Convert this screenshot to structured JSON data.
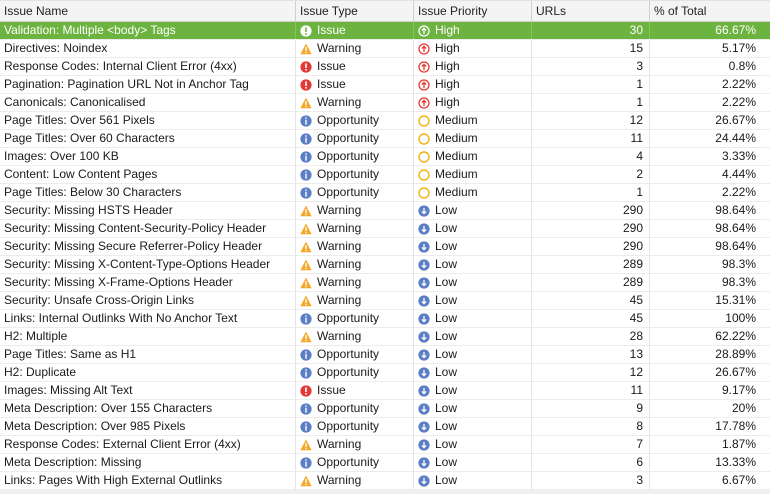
{
  "columns": [
    "Issue Name",
    "Issue Type",
    "Issue Priority",
    "URLs",
    "% of Total"
  ],
  "colors": {
    "selected_row": "#6cb33f",
    "issue": "#e53935",
    "warning": "#f5a623",
    "opportunity": "#5b7fc7",
    "high": "#e53935",
    "medium": "#f2b20f",
    "low": "#5b7fc7"
  },
  "rows": [
    {
      "name": "Validation: Multiple <body> Tags",
      "type": "Issue",
      "priority": "High",
      "urls": "30",
      "pct": "66.67%",
      "selected": true
    },
    {
      "name": "Directives: Noindex",
      "type": "Warning",
      "priority": "High",
      "urls": "15",
      "pct": "5.17%"
    },
    {
      "name": "Response Codes: Internal Client Error (4xx)",
      "type": "Issue",
      "priority": "High",
      "urls": "3",
      "pct": "0.8%"
    },
    {
      "name": "Pagination: Pagination URL Not in Anchor Tag",
      "type": "Issue",
      "priority": "High",
      "urls": "1",
      "pct": "2.22%"
    },
    {
      "name": "Canonicals: Canonicalised",
      "type": "Warning",
      "priority": "High",
      "urls": "1",
      "pct": "2.22%"
    },
    {
      "name": "Page Titles: Over 561 Pixels",
      "type": "Opportunity",
      "priority": "Medium",
      "urls": "12",
      "pct": "26.67%"
    },
    {
      "name": "Page Titles: Over 60 Characters",
      "type": "Opportunity",
      "priority": "Medium",
      "urls": "11",
      "pct": "24.44%"
    },
    {
      "name": "Images: Over 100 KB",
      "type": "Opportunity",
      "priority": "Medium",
      "urls": "4",
      "pct": "3.33%"
    },
    {
      "name": "Content: Low Content Pages",
      "type": "Opportunity",
      "priority": "Medium",
      "urls": "2",
      "pct": "4.44%"
    },
    {
      "name": "Page Titles: Below 30 Characters",
      "type": "Opportunity",
      "priority": "Medium",
      "urls": "1",
      "pct": "2.22%"
    },
    {
      "name": "Security: Missing HSTS Header",
      "type": "Warning",
      "priority": "Low",
      "urls": "290",
      "pct": "98.64%"
    },
    {
      "name": "Security: Missing Content-Security-Policy Header",
      "type": "Warning",
      "priority": "Low",
      "urls": "290",
      "pct": "98.64%"
    },
    {
      "name": "Security: Missing Secure Referrer-Policy Header",
      "type": "Warning",
      "priority": "Low",
      "urls": "290",
      "pct": "98.64%"
    },
    {
      "name": "Security: Missing X-Content-Type-Options Header",
      "type": "Warning",
      "priority": "Low",
      "urls": "289",
      "pct": "98.3%"
    },
    {
      "name": "Security: Missing X-Frame-Options Header",
      "type": "Warning",
      "priority": "Low",
      "urls": "289",
      "pct": "98.3%"
    },
    {
      "name": "Security: Unsafe Cross-Origin Links",
      "type": "Warning",
      "priority": "Low",
      "urls": "45",
      "pct": "15.31%"
    },
    {
      "name": "Links: Internal Outlinks With No Anchor Text",
      "type": "Opportunity",
      "priority": "Low",
      "urls": "45",
      "pct": "100%"
    },
    {
      "name": "H2: Multiple",
      "type": "Warning",
      "priority": "Low",
      "urls": "28",
      "pct": "62.22%"
    },
    {
      "name": "Page Titles: Same as H1",
      "type": "Opportunity",
      "priority": "Low",
      "urls": "13",
      "pct": "28.89%"
    },
    {
      "name": "H2: Duplicate",
      "type": "Opportunity",
      "priority": "Low",
      "urls": "12",
      "pct": "26.67%"
    },
    {
      "name": "Images: Missing Alt Text",
      "type": "Issue",
      "priority": "Low",
      "urls": "11",
      "pct": "9.17%"
    },
    {
      "name": "Meta Description: Over 155 Characters",
      "type": "Opportunity",
      "priority": "Low",
      "urls": "9",
      "pct": "20%"
    },
    {
      "name": "Meta Description: Over 985 Pixels",
      "type": "Opportunity",
      "priority": "Low",
      "urls": "8",
      "pct": "17.78%"
    },
    {
      "name": "Response Codes: External Client Error (4xx)",
      "type": "Warning",
      "priority": "Low",
      "urls": "7",
      "pct": "1.87%"
    },
    {
      "name": "Meta Description: Missing",
      "type": "Opportunity",
      "priority": "Low",
      "urls": "6",
      "pct": "13.33%"
    },
    {
      "name": "Links: Pages With High External Outlinks",
      "type": "Warning",
      "priority": "Low",
      "urls": "3",
      "pct": "6.67%"
    }
  ]
}
